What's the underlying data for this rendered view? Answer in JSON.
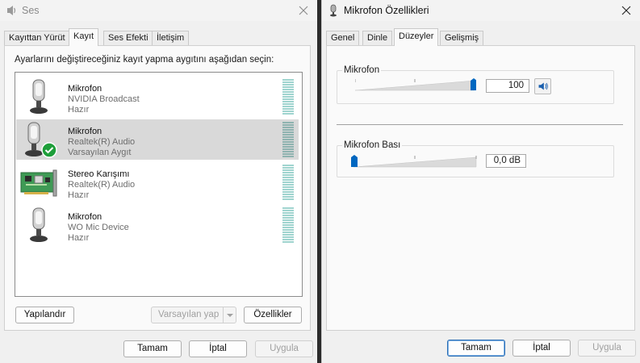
{
  "left_window": {
    "title": "Ses",
    "tabs": [
      "Kayıttan Yürüt",
      "Kayıt",
      "Ses Efekti",
      "İletişim"
    ],
    "active_tab": "Kayıt",
    "instruction": "Ayarlarını değiştireceğiniz kayıt yapma aygıtını aşağıdan seçin:",
    "devices": [
      {
        "name": "Mikrofon",
        "subtitle": "NVIDIA Broadcast",
        "status": "Hazır",
        "icon": "microphone-icon",
        "selected": false
      },
      {
        "name": "Mikrofon",
        "subtitle": "Realtek(R) Audio",
        "status": "Varsayılan Aygıt",
        "icon": "microphone-default-icon",
        "selected": true
      },
      {
        "name": "Stereo Karışımı",
        "subtitle": "Realtek(R) Audio",
        "status": "Hazır",
        "icon": "circuit-board-icon",
        "selected": false
      },
      {
        "name": "Mikrofon",
        "subtitle": "WO Mic Device",
        "status": "Hazır",
        "icon": "microphone-icon",
        "selected": false
      }
    ],
    "buttons": {
      "configure": "Yapılandır",
      "set_default": "Varsayılan yap",
      "properties": "Özellikler",
      "ok": "Tamam",
      "cancel": "İptal",
      "apply": "Uygula"
    }
  },
  "right_window": {
    "title": "Mikrofon Özellikleri",
    "tabs": [
      "Genel",
      "Dinle",
      "Düzeyler",
      "Gelişmiş"
    ],
    "active_tab": "Düzeyler",
    "microphone": {
      "label": "Mikrofon",
      "value": "100",
      "level_fraction": 1.0
    },
    "boost": {
      "label": "Mikrofon Bası",
      "value": "0,0 dB",
      "level_fraction": 0.0
    },
    "buttons": {
      "ok": "Tamam",
      "cancel": "İptal",
      "apply": "Uygula"
    }
  },
  "colors": {
    "accent": "#0067c0",
    "check_green": "#1e9e3a",
    "meter": "#9fd4cf",
    "selected_row": "#d9d9d9"
  }
}
